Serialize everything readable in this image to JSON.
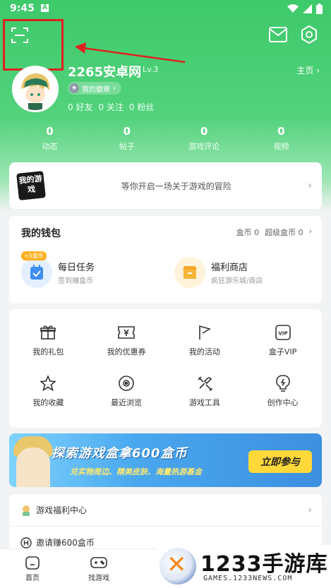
{
  "status_bar": {
    "time": "9:45",
    "a_icon": "A"
  },
  "header": {
    "username": "2265安卓网",
    "level": "Lv.3",
    "homepage_label": "主页",
    "badge_label": "我的徽章",
    "friends": "0 好友",
    "following": "0 关注",
    "followers": "0 粉丝",
    "stats": [
      {
        "value": "0",
        "label": "动态"
      },
      {
        "value": "0",
        "label": "帖子"
      },
      {
        "value": "0",
        "label": "游戏评论"
      },
      {
        "value": "0",
        "label": "视频"
      }
    ]
  },
  "game_card": {
    "logo_text": "我的游戏",
    "message": "等你开启一场关于游戏的冒险"
  },
  "wallet": {
    "title": "我的钱包",
    "coins": "盒币 0",
    "super_coins": "超级盒币 0",
    "daily": {
      "title": "每日任务",
      "sub": "签到赚盒币",
      "tag": "+5盒币"
    },
    "shop": {
      "title": "福利商店",
      "sub": "疯狂游乐城/商店"
    }
  },
  "grid": [
    {
      "label": "我的礼包",
      "icon": "gift-icon"
    },
    {
      "label": "我的优惠券",
      "icon": "coupon-icon"
    },
    {
      "label": "我的活动",
      "icon": "flag-icon"
    },
    {
      "label": "盒子VIP",
      "icon": "vip-icon"
    },
    {
      "label": "我的收藏",
      "icon": "star-icon"
    },
    {
      "label": "最近浏览",
      "icon": "eye-icon"
    },
    {
      "label": "游戏工具",
      "icon": "tool-icon"
    },
    {
      "label": "创作中心",
      "icon": "bulb-icon"
    }
  ],
  "banner": {
    "title": "探索游戏盒拿600盒币",
    "subtitle": "兑实物周边、精美皮肤、海量热游基金",
    "button": "立即参与"
  },
  "list": [
    {
      "label": "游戏福利中心"
    },
    {
      "label": "邀请赚600盒币"
    }
  ],
  "bottom_nav": [
    {
      "label": "首页"
    },
    {
      "label": "找游戏"
    }
  ],
  "watermark": {
    "title": "1233手游库",
    "sub": "GAMES.1233NEWS.COM"
  },
  "colors": {
    "brand_green": "#3ec96a",
    "highlight_red": "#e02020",
    "coin_orange": "#ffb020"
  }
}
